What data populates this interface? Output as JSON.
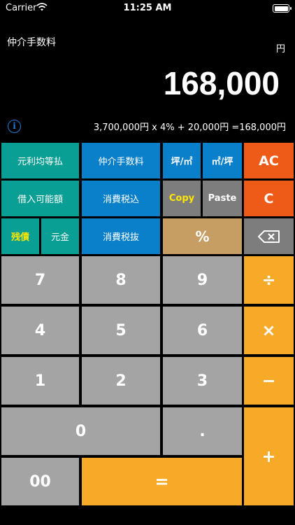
{
  "status_bar": {
    "carrier": "Carrier",
    "time": "11:25 AM"
  },
  "header": {
    "mode_title": "仲介手数料",
    "unit": "円"
  },
  "display": {
    "value": "168,000"
  },
  "formula": {
    "text": "3,700,000円 x 4% + 20,000円 =168,000円"
  },
  "info_icon": {
    "glyph": "i"
  },
  "function_keys": {
    "gansoku": "元利均等払",
    "chukai": "仲介手数料",
    "tsubo_m2": "坪/㎡",
    "m2_tsubo": "㎡/坪",
    "ac": "AC",
    "shakunyu": "借入可能額",
    "zeikomi": "消費税込",
    "copy": "Copy",
    "paste": "Paste",
    "c": "C",
    "zansai": "残債",
    "gankin": "元金",
    "zeinuki": "消費税抜",
    "percent": "%"
  },
  "numpad": {
    "k7": "7",
    "k8": "8",
    "k9": "9",
    "k4": "4",
    "k5": "5",
    "k6": "6",
    "k1": "1",
    "k2": "2",
    "k3": "3",
    "k0": "0",
    "dot": ".",
    "k00": "00"
  },
  "operators": {
    "divide": "÷",
    "multiply": "×",
    "minus": "−",
    "plus": "+",
    "equals": "="
  },
  "colors": {
    "teal": "#0a9f95",
    "blue": "#0a7fca",
    "orange": "#ee5b18",
    "gray": "#7d7d7d",
    "tan": "#c69e63",
    "number": "#a4a4a4",
    "operator": "#f7a928",
    "copy_text": "#ffe600"
  }
}
